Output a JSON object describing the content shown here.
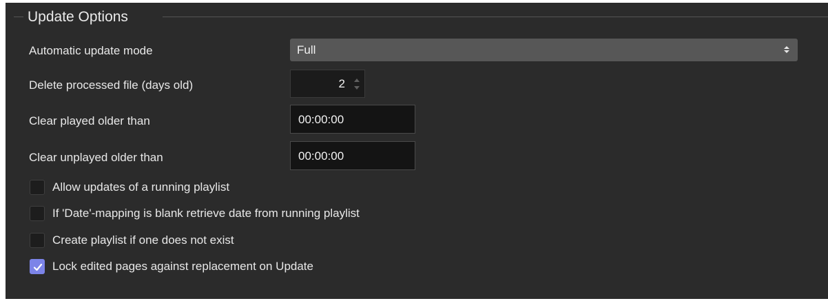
{
  "group": {
    "title": "Update Options"
  },
  "fields": {
    "auto_update_mode": {
      "label": "Automatic update mode",
      "value": "Full"
    },
    "delete_processed": {
      "label": "Delete processed file (days old)",
      "value": "2"
    },
    "clear_played": {
      "label": "Clear played older than",
      "value": "00:00:00"
    },
    "clear_unplayed": {
      "label": "Clear unplayed older than",
      "value": "00:00:00"
    }
  },
  "checkboxes": [
    {
      "label": "Allow updates of a running playlist",
      "checked": false
    },
    {
      "label": "If 'Date'-mapping is blank retrieve date from running playlist",
      "checked": false
    },
    {
      "label": "Create playlist if one does not exist",
      "checked": false
    },
    {
      "label": "Lock edited pages against replacement on Update",
      "checked": true
    }
  ],
  "colors": {
    "panel_bg": "#2b2b2b",
    "accent": "#7c84e8",
    "select_bg": "#575757",
    "input_bg": "#141414"
  }
}
